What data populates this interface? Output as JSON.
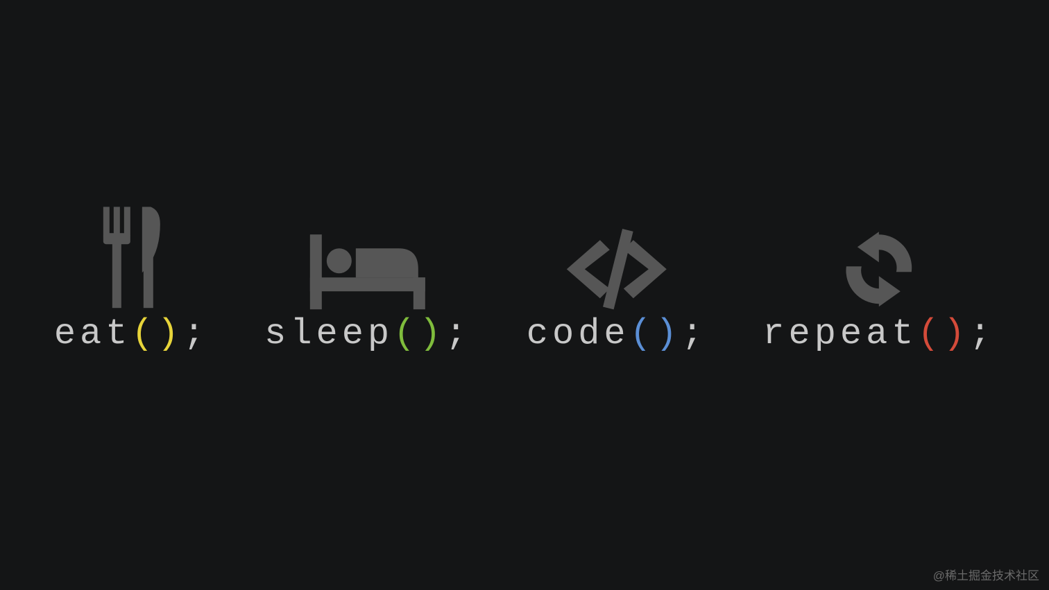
{
  "items": [
    {
      "word": "eat",
      "paren_color": "#e7d43a",
      "icon": "utensils"
    },
    {
      "word": "sleep",
      "paren_color": "#7fbc3c",
      "icon": "bed"
    },
    {
      "word": "code",
      "paren_color": "#5b8fd6",
      "icon": "code"
    },
    {
      "word": "repeat",
      "paren_color": "#d44b3a",
      "icon": "refresh"
    }
  ],
  "colors": {
    "text": "#c8c8c8",
    "icon": "#565656",
    "bg": "#141516"
  },
  "watermark": "@稀土掘金技术社区"
}
